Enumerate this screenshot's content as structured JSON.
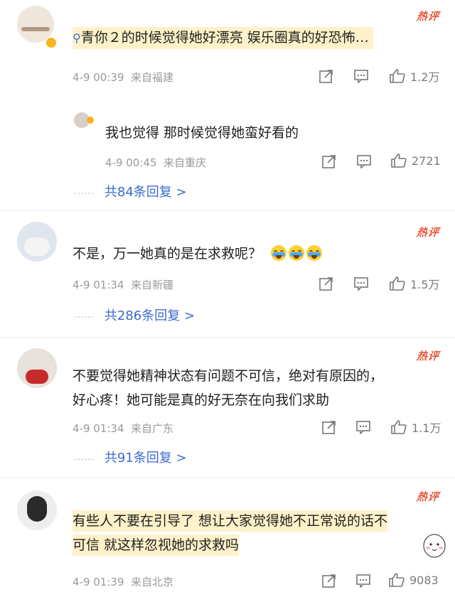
{
  "comments": [
    {
      "hot_label": "热评",
      "text": "青你２的时候觉得她好漂亮 娱乐圈真的好恐怖…",
      "date": "4-9 00:39",
      "location": "来自福建",
      "likes": "1.2万",
      "reply": {
        "text": "我也觉得 那时候觉得她蛮好看的",
        "date": "4-9 00:45",
        "location": "来自重庆",
        "likes": "2721"
      },
      "replies_link": "共84条回复 >"
    },
    {
      "hot_label": "热评",
      "text": "不是，万一她真的是在求救呢？",
      "date": "4-9 01:34",
      "location": "来自新疆",
      "likes": "1.5万",
      "replies_link": "共286条回复 >"
    },
    {
      "hot_label": "热评",
      "text_line1": "不要觉得她精神状态有问题不可信，绝对有原因的，",
      "text_line2": "好心疼！她可能是真的好无奈在向我们求助",
      "date": "4-9 01:34",
      "location": "来自广东",
      "likes": "1.1万",
      "replies_link": "共91条回复 >"
    },
    {
      "hot_label": "热评",
      "text_line1": "有些人不要在引导了 想让大家觉得她不正常说的话不",
      "text_line2": "可信 就这样忽视她的求救吗",
      "date": "4-9 01:39",
      "location": "来自北京",
      "likes": "9083"
    }
  ],
  "icons": {
    "share": "share-icon",
    "comment": "comment-icon",
    "like": "thumbs-up-icon",
    "verified": "verified-badge-icon",
    "search": "search-icon"
  },
  "colors": {
    "hot": "#e9553a",
    "link": "#3a6bd0",
    "meta": "#9a9a9a",
    "highlight": "#fff1c9"
  }
}
